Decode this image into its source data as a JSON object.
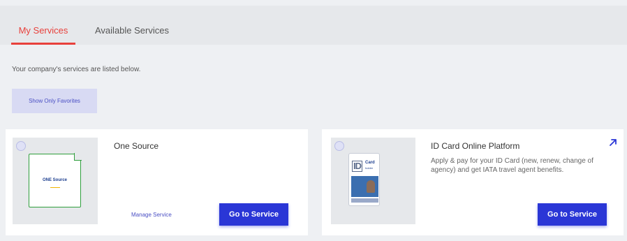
{
  "tabs": [
    {
      "label": "My Services",
      "active": true
    },
    {
      "label": "Available Services",
      "active": false
    }
  ],
  "intro_text": "Your company's services are listed below.",
  "favorites_button": "Show Only Favorites",
  "colors": {
    "accent": "#e8413c",
    "primary": "#2a36d6",
    "link": "#4a4fc4"
  },
  "cards": [
    {
      "title": "One Source",
      "logo_text": "ONE Source",
      "manage_label": "Manage Service",
      "go_label": "Go to Service"
    },
    {
      "title": "ID Card Online Platform",
      "description": "Apply & pay for your ID Card (new, renew, change of agency) and get IATA travel agent benefits.",
      "logo_id": "ID",
      "logo_card": "Card",
      "logo_holder": "holder",
      "go_label": "Go to Service",
      "external_icon": "arrow-up-right-icon"
    }
  ]
}
